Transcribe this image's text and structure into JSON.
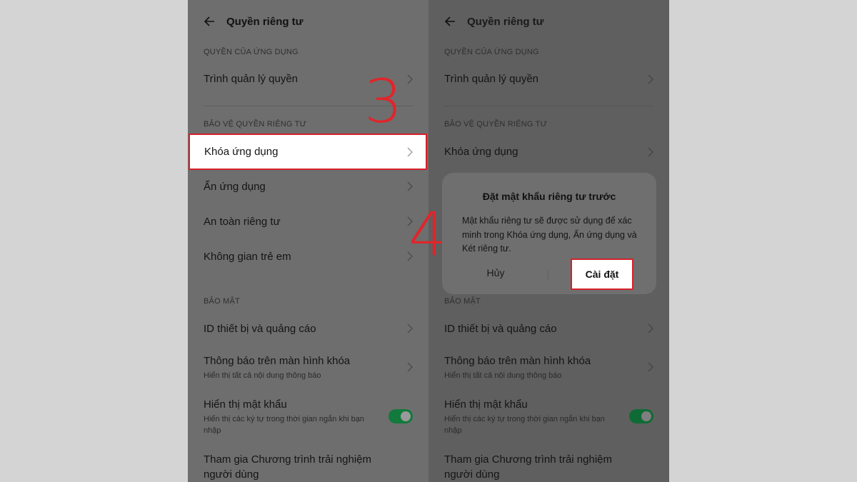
{
  "screen": {
    "title": "Quyền riêng tư",
    "sections": {
      "app_permissions": "QUYỀN CỦA ỨNG DỤNG",
      "privacy_protection": "BẢO VỆ QUYỀN RIÊNG TƯ",
      "security": "BẢO MẬT"
    },
    "items": {
      "permission_manager": "Trình quản lý quyền",
      "app_lock": "Khóa ứng dụng",
      "hide_apps": "Ẩn ứng dụng",
      "privacy_safety": "An toàn riêng tư",
      "kids_space": "Không gian trẻ em",
      "device_id_ads": "ID thiết bị và quảng cáo",
      "lockscreen_notifications": "Thông báo trên màn hình khóa",
      "lockscreen_notifications_sub": "Hiển thị tất cả nội dung thông báo",
      "show_password": "Hiển thị mật khẩu",
      "show_password_sub": "Hiển thị các ký tự trong thời gian ngắn khi bạn nhập",
      "user_experience_line1": "Tham gia Chương trình trải nghiệm",
      "user_experience_line2": "người dùng"
    },
    "show_password_enabled": true
  },
  "dialog": {
    "title": "Đặt mật khẩu riêng tư trước",
    "body": "Mật khẩu riêng tư sẽ được sử dụng để xác minh trong Khóa ứng dụng, Ẩn ứng dụng và Két riêng tư.",
    "cancel": "Hủy",
    "confirm": "Cài đặt"
  },
  "annotations": {
    "step3": "3",
    "step4": "4"
  },
  "colors": {
    "highlight": "#d5222b",
    "toggle_on": "#117a3c"
  },
  "icons": [
    "back-arrow-icon",
    "chevron-right-icon"
  ]
}
